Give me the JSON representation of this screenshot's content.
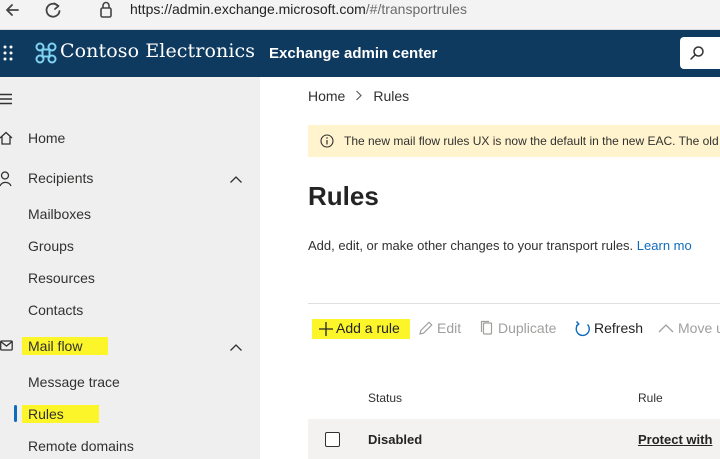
{
  "browser": {
    "url_host": "https://admin.exchange.microsoft.com",
    "url_path": "/#/transportrules"
  },
  "header": {
    "org_name": "Contoso Electronics",
    "app_title": "Exchange admin center"
  },
  "sidebar": {
    "items": [
      {
        "label": "Home",
        "icon": "home-icon"
      },
      {
        "label": "Recipients",
        "icon": "person-icon",
        "expanded": true
      },
      {
        "label": "Mailboxes"
      },
      {
        "label": "Groups"
      },
      {
        "label": "Resources"
      },
      {
        "label": "Contacts"
      },
      {
        "label": "Mail flow",
        "icon": "mail-icon",
        "expanded": true,
        "highlighted": true
      },
      {
        "label": "Message trace"
      },
      {
        "label": "Rules",
        "selected": true,
        "highlighted": true
      },
      {
        "label": "Remote domains"
      }
    ]
  },
  "main": {
    "breadcrumb": [
      "Home",
      "Rules"
    ],
    "banner_text": "The new mail flow rules UX is now the default in the new EAC. The old r",
    "title": "Rules",
    "description": "Add, edit, or make other changes to your transport rules. ",
    "description_link": "Learn mo",
    "toolbar": {
      "add": "Add a rule",
      "edit": "Edit",
      "duplicate": "Duplicate",
      "refresh": "Refresh",
      "move": "Move u"
    },
    "table": {
      "columns": [
        "Status",
        "Rule"
      ],
      "rows": [
        {
          "status": "Disabled",
          "rule": "Protect with"
        }
      ]
    }
  },
  "colors": {
    "header_bg": "#0f3a5f",
    "sidebar_bg": "#efefef",
    "accent": "#0f6cbd",
    "banner_bg": "#fff4ce",
    "highlight": "#fbf52a"
  }
}
